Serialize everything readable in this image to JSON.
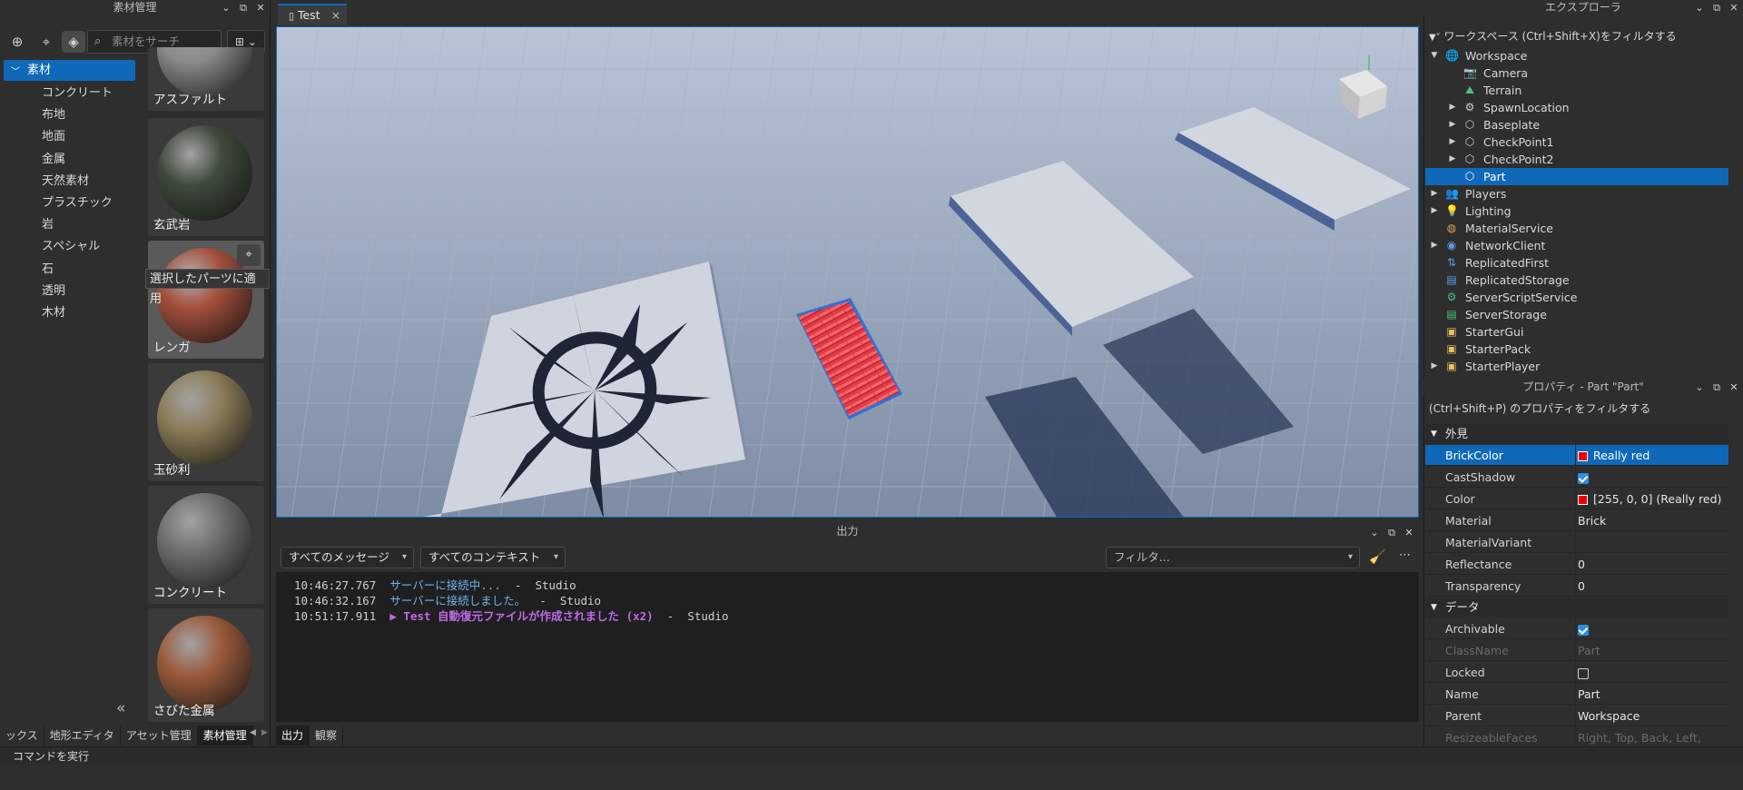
{
  "left_panel": {
    "title": "素材管理",
    "search_placeholder": "素材をサーチ",
    "view_label": "⊞ ⌄",
    "selected_category": "素材",
    "categories": [
      "コンクリート",
      "布地",
      "地面",
      "金属",
      "天然素材",
      "プラスチック",
      "岩",
      "スペシャル",
      "石",
      "透明",
      "木材"
    ],
    "tiles": [
      {
        "label": "アスファルト",
        "color": "#8a8a8a"
      },
      {
        "label": "玄武岩",
        "color": "#3f4a3c"
      },
      {
        "label": "レンガ",
        "color": "#a44f3c"
      },
      {
        "label": "玉砂利",
        "color": "#8b7c58"
      },
      {
        "label": "コンクリート",
        "color": "#6e6e6c"
      },
      {
        "label": "さびた金属",
        "color": "#9a5a3b"
      }
    ],
    "tooltip": "選択したパーツに適用",
    "collapse": "«"
  },
  "bottom_tabs_left": [
    "ックス",
    "地形エディタ",
    "アセット管理",
    "素材管理"
  ],
  "bottom_tabs_left_active": 3,
  "bottom_tabs_output": [
    "出力",
    "観察"
  ],
  "doc_tab": {
    "label": "Test",
    "close": "×"
  },
  "output": {
    "title": "出力",
    "messages_filter": "すべてのメッセージ",
    "context_filter": "すべてのコンテキスト",
    "filter_placeholder": "フィルタ...",
    "lines": [
      {
        "time": "10:46:27.767",
        "text": "サーバーに接続中...",
        "sep": "  -  ",
        "source": "Studio",
        "color": "#6fb3ea"
      },
      {
        "time": "10:46:32.167",
        "text": "サーバーに接続しました。",
        "sep": "  -  ",
        "source": "Studio",
        "color": "#6fb3ea"
      },
      {
        "time": "10:51:17.911",
        "text": "▶ Test 自動復元ファイルが作成されました (x2)",
        "sep": "  -  ",
        "source": "Studio",
        "color": "#c06ae8"
      }
    ]
  },
  "explorer": {
    "title": "エクスプローラ",
    "filter": "ワークスペース (Ctrl+Shift+X)をフィルタする",
    "items": [
      {
        "label": "Workspace",
        "depth": 0,
        "arrow": "▼",
        "icon": "🌐",
        "color": "#5aa0e8"
      },
      {
        "label": "Camera",
        "depth": 1,
        "arrow": "",
        "icon": "📷",
        "color": "#cfcfcf"
      },
      {
        "label": "Terrain",
        "depth": 1,
        "arrow": "",
        "icon": "⛰",
        "color": "#4ec07a"
      },
      {
        "label": "SpawnLocation",
        "depth": 1,
        "arrow": "▶",
        "icon": "⚙",
        "color": "#cfcfcf"
      },
      {
        "label": "Baseplate",
        "depth": 1,
        "arrow": "▶",
        "icon": "⬡",
        "color": "#cfcfcf"
      },
      {
        "label": "CheckPoint1",
        "depth": 1,
        "arrow": "▶",
        "icon": "⬡",
        "color": "#cfcfcf"
      },
      {
        "label": "CheckPoint2",
        "depth": 1,
        "arrow": "▶",
        "icon": "⬡",
        "color": "#cfcfcf"
      },
      {
        "label": "Part",
        "depth": 1,
        "arrow": "",
        "icon": "⬡",
        "color": "#ffffff",
        "selected": true
      },
      {
        "label": "Players",
        "depth": 0,
        "arrow": "▶",
        "icon": "👥",
        "color": "#e8a84a"
      },
      {
        "label": "Lighting",
        "depth": 0,
        "arrow": "▶",
        "icon": "💡",
        "color": "#f0d040"
      },
      {
        "label": "MaterialService",
        "depth": 0,
        "arrow": "",
        "icon": "◍",
        "color": "#e0a060"
      },
      {
        "label": "NetworkClient",
        "depth": 0,
        "arrow": "▶",
        "icon": "◉",
        "color": "#5aa0e8"
      },
      {
        "label": "ReplicatedFirst",
        "depth": 0,
        "arrow": "",
        "icon": "⇅",
        "color": "#5aa0e8"
      },
      {
        "label": "ReplicatedStorage",
        "depth": 0,
        "arrow": "",
        "icon": "▤",
        "color": "#5aa0e8"
      },
      {
        "label": "ServerScriptService",
        "depth": 0,
        "arrow": "",
        "icon": "⚙",
        "color": "#4ec07a"
      },
      {
        "label": "ServerStorage",
        "depth": 0,
        "arrow": "",
        "icon": "▤",
        "color": "#4ec07a"
      },
      {
        "label": "StarterGui",
        "depth": 0,
        "arrow": "",
        "icon": "▣",
        "color": "#e8c060"
      },
      {
        "label": "StarterPack",
        "depth": 0,
        "arrow": "",
        "icon": "▣",
        "color": "#e8c060"
      },
      {
        "label": "StarterPlayer",
        "depth": 0,
        "arrow": "▶",
        "icon": "▣",
        "color": "#e8c060"
      }
    ]
  },
  "properties": {
    "title": "プロパティ - Part \"Part\"",
    "filter": "(Ctrl+Shift+P) のプロパティをフィルタする",
    "sections": [
      {
        "name": "外見",
        "rows": [
          {
            "key": "BrickColor",
            "value": "Really red",
            "swatch": true,
            "selected": true
          },
          {
            "key": "CastShadow",
            "check": true
          },
          {
            "key": "Color",
            "value": "[255, 0, 0] (Really red)",
            "swatch": true
          },
          {
            "key": "Material",
            "value": "Brick"
          },
          {
            "key": "MaterialVariant",
            "value": ""
          },
          {
            "key": "Reflectance",
            "value": "0"
          },
          {
            "key": "Transparency",
            "value": "0"
          }
        ]
      },
      {
        "name": "データ",
        "rows": [
          {
            "key": "Archivable",
            "check": true
          },
          {
            "key": "ClassName",
            "value": "Part",
            "dim": true
          },
          {
            "key": "Locked",
            "check": false
          },
          {
            "key": "Name",
            "value": "Part"
          },
          {
            "key": "Parent",
            "value": "Workspace"
          },
          {
            "key": "ResizeableFaces",
            "value": "Right, Top, Back, Left, Bott...",
            "dim": true
          }
        ]
      }
    ]
  },
  "command_bar": "コマンドを実行",
  "colors": {
    "accent": "#0f69b8",
    "brick": "#d9303a"
  }
}
